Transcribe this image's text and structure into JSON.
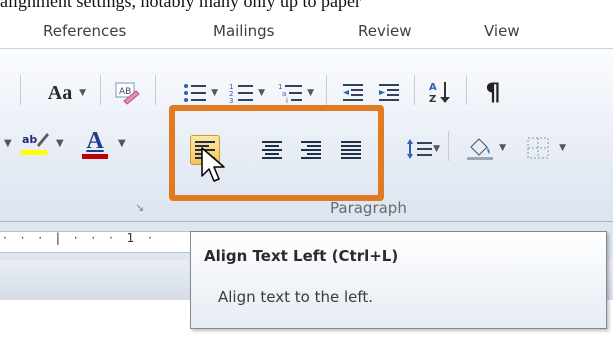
{
  "caption_fragment": "alignment settings, notably many only up to paper",
  "tabs": [
    {
      "label": "References"
    },
    {
      "label": "Mailings"
    },
    {
      "label": "Review"
    },
    {
      "label": "View"
    }
  ],
  "ribbon": {
    "font_size_icon": "Aa",
    "sort_icon": "A Z ↓",
    "font_color_icon": "A",
    "highlight_icon": "ab",
    "paragraph_mark": "¶",
    "group_label": "Paragraph",
    "launcher_glyph": "↘",
    "active_button": "align-left"
  },
  "ruler": {
    "text": "· · · | · · · 1 ·"
  },
  "tooltip": {
    "title": "Align Text Left (Ctrl+L)",
    "description": "Align text to the left."
  },
  "colors": {
    "highlight_box": "#e07b22",
    "active_fill": "#f8c25a",
    "highlight_yellow": "#ffff00",
    "font_red": "#c00000"
  }
}
